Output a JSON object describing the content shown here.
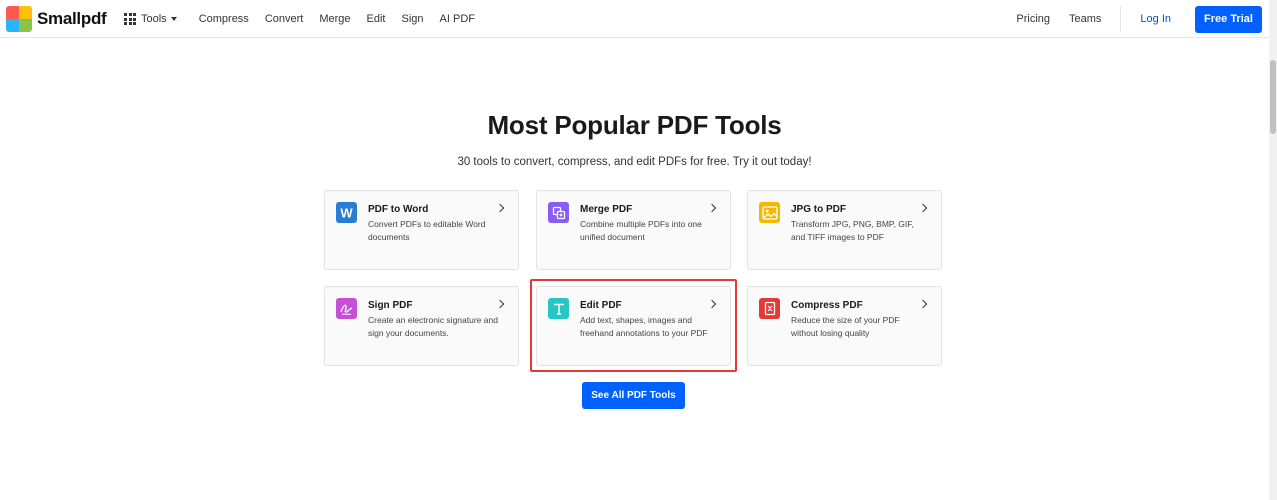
{
  "header": {
    "logo_text": "Smallpdf",
    "tools_label": "Tools",
    "nav_links": [
      "Compress",
      "Convert",
      "Merge",
      "Edit",
      "Sign",
      "AI PDF"
    ],
    "right_links": [
      "Pricing",
      "Teams"
    ],
    "login": "Log In",
    "trial": "Free Trial",
    "logo_colors": [
      "#ff5a4e",
      "#ffc107",
      "#29b6f6",
      "#8bc34a"
    ]
  },
  "main": {
    "title": "Most Popular PDF Tools",
    "subtitle": "30 tools to convert, compress, and edit PDFs for free. Try it out today!",
    "see_all": "See All PDF Tools",
    "cards": [
      {
        "title": "PDF to Word",
        "desc": "Convert PDFs to editable Word documents",
        "icon": "word-icon",
        "color": "#2b7cd3"
      },
      {
        "title": "Merge PDF",
        "desc": "Combine multiple PDFs into one unified document",
        "icon": "merge-icon",
        "color": "#8a5cf6"
      },
      {
        "title": "JPG to PDF",
        "desc": "Transform JPG, PNG, BMP, GIF, and TIFF images to PDF",
        "icon": "image-icon",
        "color": "#f5b800"
      },
      {
        "title": "Sign PDF",
        "desc": "Create an electronic signature and sign your documents.",
        "icon": "signature-icon",
        "color": "#c64fd6"
      },
      {
        "title": "Edit PDF",
        "desc": "Add text, shapes, images and freehand annotations to your PDF",
        "icon": "text-icon",
        "color": "#26c6c6"
      },
      {
        "title": "Compress PDF",
        "desc": "Reduce the size of your PDF without losing quality",
        "icon": "compress-icon",
        "color": "#e53935"
      }
    ]
  }
}
